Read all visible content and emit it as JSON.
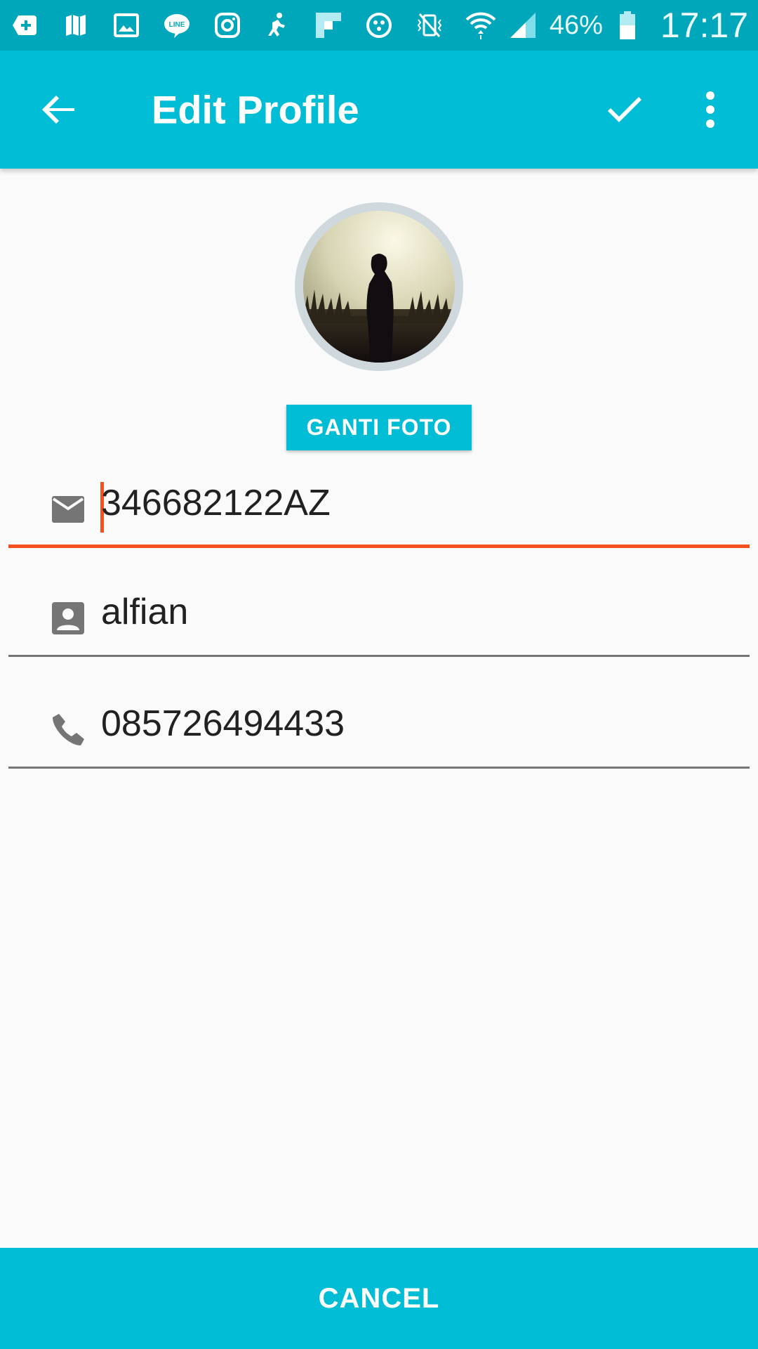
{
  "status_bar": {
    "battery_percent": "46%",
    "time": "17:17",
    "icons": [
      "add-box-icon",
      "map-icon",
      "image-icon",
      "line-icon",
      "instagram-icon",
      "accessibility-icon",
      "flipboard-icon",
      "dots-icon",
      "vibrate-mute-icon",
      "wifi-icon",
      "signal-icon",
      "battery-icon"
    ]
  },
  "app_bar": {
    "title": "Edit Profile",
    "back_icon": "arrow-back-icon",
    "confirm_icon": "check-icon",
    "menu_icon": "more-vert-icon"
  },
  "profile": {
    "change_photo_label": "GANTI FOTO"
  },
  "fields": {
    "email": {
      "icon": "email-icon",
      "value": "346682122AZ"
    },
    "name": {
      "icon": "person-icon",
      "value": "alfian"
    },
    "phone": {
      "icon": "phone-icon",
      "value": "085726494433"
    }
  },
  "footer": {
    "cancel_label": "CANCEL"
  },
  "colors": {
    "primary": "#00bcd4",
    "status_bar": "#00a7bb",
    "accent": "#f4511e",
    "background": "#fafafa"
  }
}
